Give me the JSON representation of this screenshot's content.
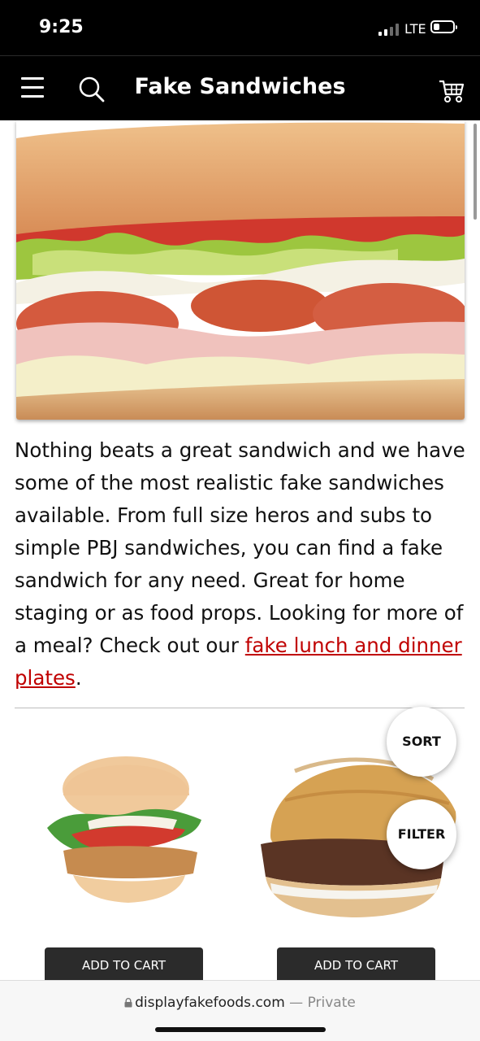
{
  "status_bar": {
    "time": "9:25",
    "network": "LTE"
  },
  "header": {
    "title": "Fake Sandwiches",
    "icons": [
      "menu-icon",
      "search-icon",
      "cart-icon"
    ]
  },
  "hero": {
    "image": "sub sandwich with ham, pepperoni, cheese, lettuce, tomato and onion"
  },
  "intro": {
    "text": "Nothing beats a great sandwich and we have some of the most realistic fake sandwiches available. From full size heros and subs to simple PBJ sandwiches, you can find a fake sandwich for any need. Great for home staging or as food props. Looking for more of a meal? Check out our ",
    "link_text": "fake lunch and dinner plates",
    "trailing": "."
  },
  "controls": {
    "sort_label": "SORT",
    "filter_label": "FILTER"
  },
  "products": [
    {
      "image": "chicken sandwich with lettuce and tomato",
      "button": "ADD TO CART"
    },
    {
      "image": "hamburger on a bun",
      "button": "ADD TO CART"
    }
  ],
  "browser": {
    "domain": "displayfakefoods.com",
    "separator": " — ",
    "mode": "Private"
  },
  "colors": {
    "link": "#c00000",
    "header_bg": "#000000",
    "button_bg": "#2b2b2b"
  }
}
